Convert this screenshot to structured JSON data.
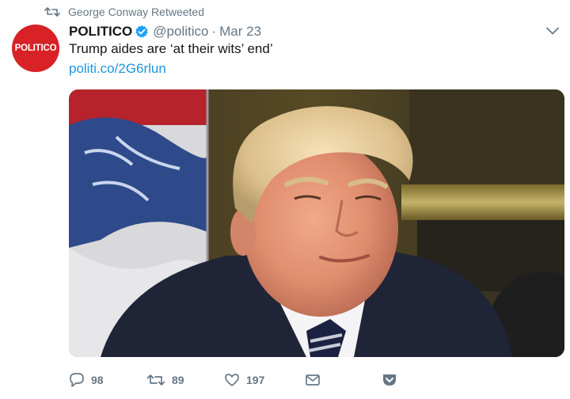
{
  "retweet_context": {
    "text": "George Conway Retweeted",
    "icon": "retweet-icon"
  },
  "author": {
    "avatar_text": "POLITICO",
    "avatar_color": "#d82226",
    "display_name": "POLITICO",
    "verified": true,
    "screen_name": "@politico",
    "separator": "·",
    "timestamp": "Mar 23"
  },
  "tweet": {
    "text": "Trump aides are ‘at their wits’ end’",
    "link": "politi.co/2G6rlun",
    "media": "photo"
  },
  "actions": {
    "reply_count": "98",
    "retweet_count": "89",
    "like_count": "197"
  },
  "colors": {
    "accent": "#1b95e0",
    "muted": "#657786",
    "verified": "#1da1f2"
  }
}
